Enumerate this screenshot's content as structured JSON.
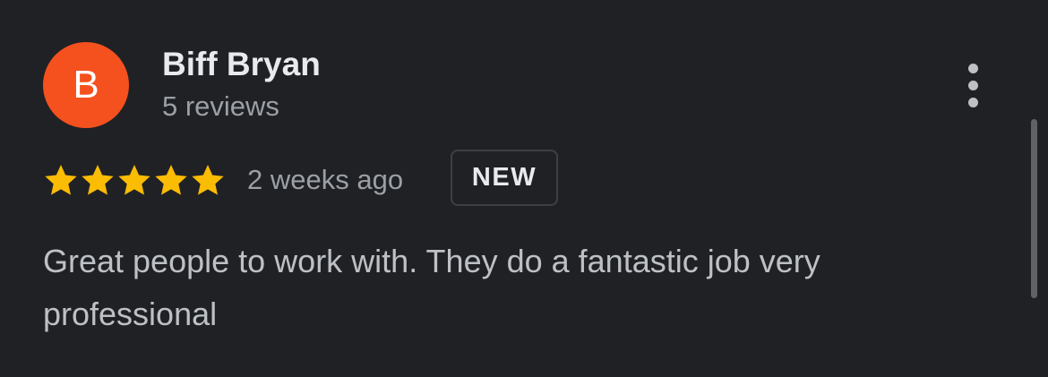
{
  "reviewer": {
    "initial": "B",
    "name": "Biff Bryan",
    "review_count": "5 reviews",
    "avatar_color": "#f4511e"
  },
  "review": {
    "rating": 5,
    "max_rating": 5,
    "star_color": "#fbbc04",
    "time_ago": "2 weeks ago",
    "badge": "NEW",
    "text": "Great people to work with. They do a fantastic job very professional"
  },
  "icons": {
    "more": "more-vertical-icon",
    "star": "star-icon"
  }
}
